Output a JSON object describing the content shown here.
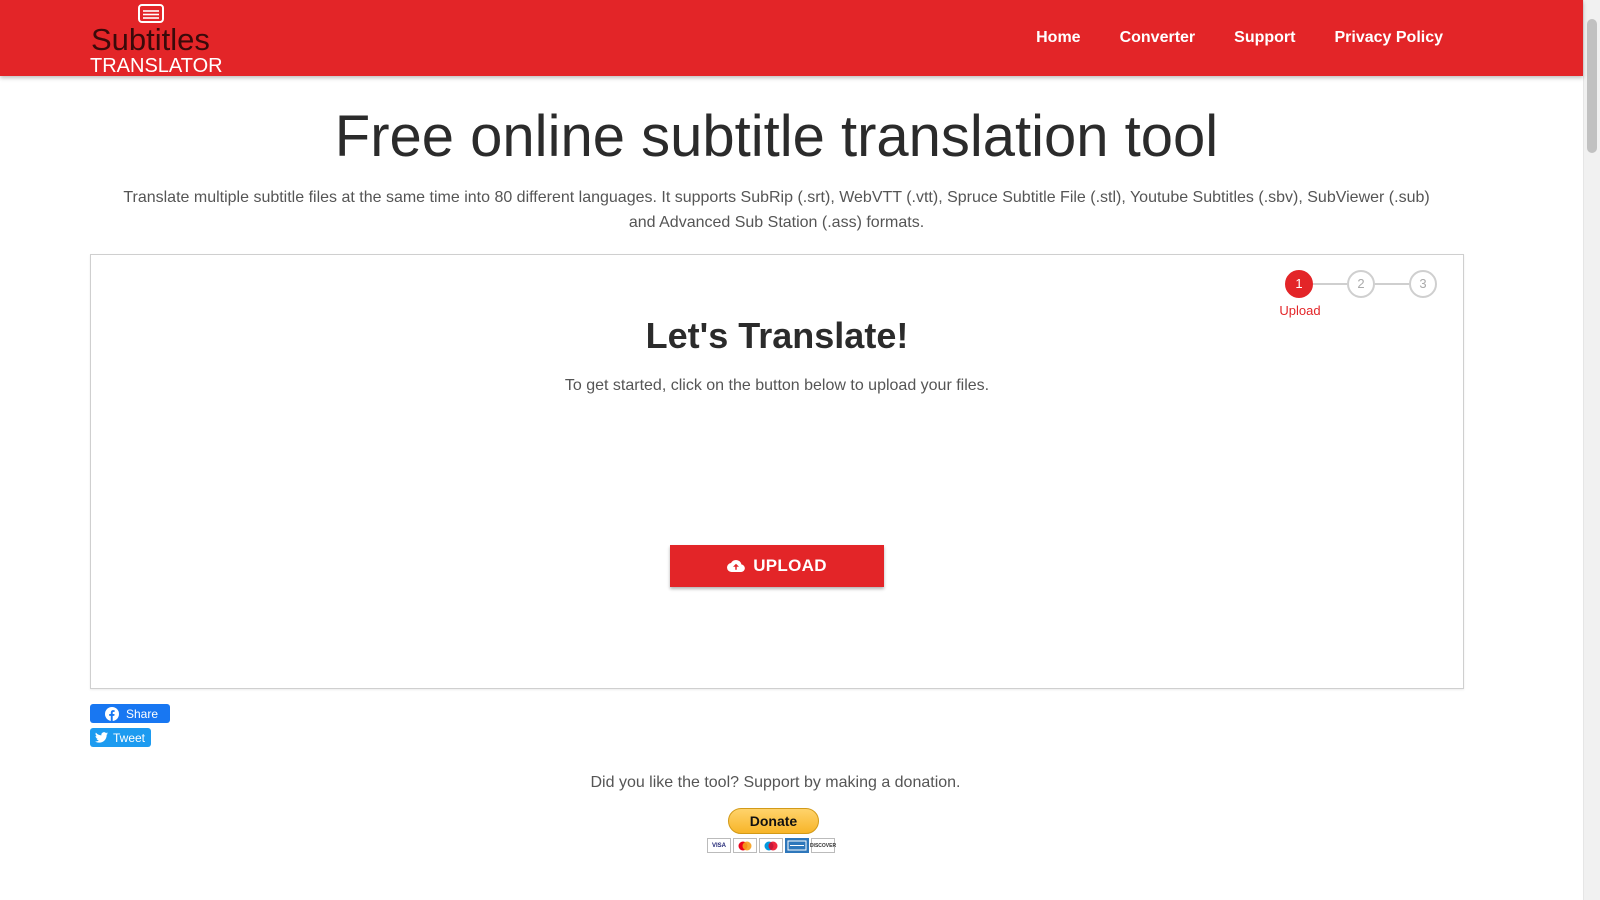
{
  "header": {
    "logo": {
      "main": "Subtitles",
      "sub": "TRANSLATOR"
    },
    "nav": [
      "Home",
      "Converter",
      "Support",
      "Privacy Policy"
    ]
  },
  "hero": {
    "title": "Free online subtitle translation tool",
    "description": "Translate multiple subtitle files at the same time into 80 different languages. It supports SubRip (.srt), WebVTT (.vtt), Spruce Subtitle File (.stl), Youtube Subtitles (.sbv), SubViewer (.sub) and Advanced Sub Station (.ass) formats."
  },
  "card": {
    "steps": [
      {
        "number": "1",
        "label": "Upload",
        "active": true
      },
      {
        "number": "2",
        "active": false
      },
      {
        "number": "3",
        "active": false
      }
    ],
    "title": "Let's Translate!",
    "subtitle": "To get started, click on the button below to upload your files.",
    "upload_label": "UPLOAD"
  },
  "social": {
    "share_label": "Share",
    "tweet_label": "Tweet"
  },
  "donation": {
    "text": "Did you like the tool? Support by making a donation.",
    "button_label": "Donate",
    "cards": [
      "VISA",
      "mastercard-icon",
      "maestro-icon",
      "amex-icon",
      "DISCOVER"
    ]
  },
  "colors": {
    "brand_red": "#e32528",
    "facebook": "#1877f2",
    "twitter": "#1d9bf0",
    "paypal_gold": "#f7b529"
  }
}
